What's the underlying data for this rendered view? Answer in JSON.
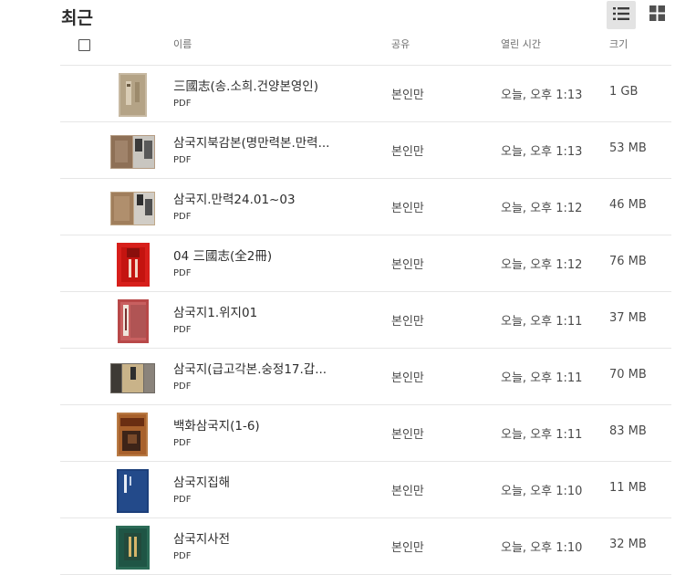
{
  "page": {
    "title": "최근"
  },
  "view": {
    "list_icon": "list-view-icon",
    "grid_icon": "grid-view-icon"
  },
  "columns": {
    "name": "이름",
    "share": "공유",
    "opened": "열린 시간",
    "size": "크기"
  },
  "files": [
    {
      "name": "三國志(송.소희.건양본영인)",
      "type": "PDF",
      "share": "본인만",
      "opened": "오늘, 오후 1:13",
      "size": "1 GB"
    },
    {
      "name": "삼국지북감본(명만력본.만력...",
      "type": "PDF",
      "share": "본인만",
      "opened": "오늘, 오후 1:13",
      "size": "53 MB"
    },
    {
      "name": "삼국지.만력24.01~03",
      "type": "PDF",
      "share": "본인만",
      "opened": "오늘, 오후 1:12",
      "size": "46 MB"
    },
    {
      "name": "04 三國志(全2冊)",
      "type": "PDF",
      "share": "본인만",
      "opened": "오늘, 오후 1:12",
      "size": "76 MB"
    },
    {
      "name": "삼국지1.위지01",
      "type": "PDF",
      "share": "본인만",
      "opened": "오늘, 오후 1:11",
      "size": "37 MB"
    },
    {
      "name": "삼국지(급고각본.숭정17.갑...",
      "type": "PDF",
      "share": "본인만",
      "opened": "오늘, 오후 1:11",
      "size": "70 MB"
    },
    {
      "name": "백화삼국지(1-6)",
      "type": "PDF",
      "share": "본인만",
      "opened": "오늘, 오후 1:11",
      "size": "83 MB"
    },
    {
      "name": "삼국지집해",
      "type": "PDF",
      "share": "본인만",
      "opened": "오늘, 오후 1:10",
      "size": "11 MB"
    },
    {
      "name": "삼국지사전",
      "type": "PDF",
      "share": "본인만",
      "opened": "오늘, 오후 1:10",
      "size": "32 MB"
    }
  ]
}
